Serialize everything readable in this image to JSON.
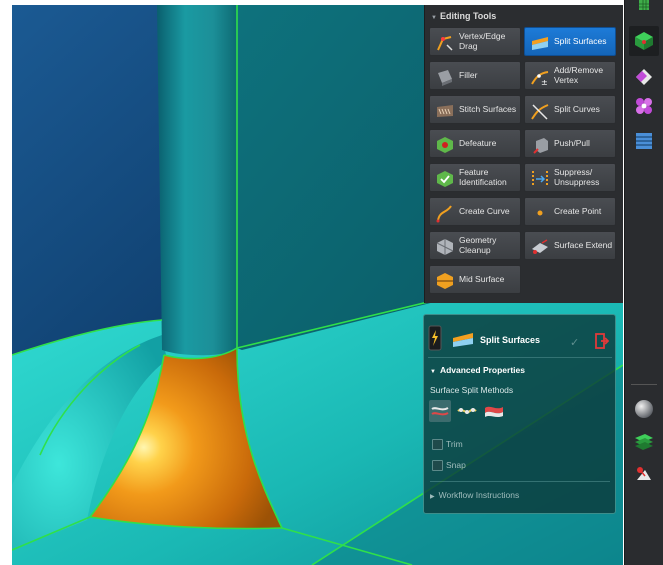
{
  "editing_tools": {
    "title": "Editing Tools",
    "buttons": [
      {
        "id": "vertex-edge-drag",
        "label": "Vertex/Edge\nDrag",
        "icon": "vertex-edge-drag-icon",
        "active": false
      },
      {
        "id": "split-surfaces",
        "label": "Split Surfaces",
        "icon": "split-surfaces-icon",
        "active": true
      },
      {
        "id": "filler",
        "label": "Filler",
        "icon": "filler-icon",
        "active": false
      },
      {
        "id": "add-remove-vertex",
        "label": "Add/Remove\nVertex",
        "icon": "add-remove-vertex-icon",
        "active": false
      },
      {
        "id": "stitch-surfaces",
        "label": "Stitch Surfaces",
        "icon": "stitch-surfaces-icon",
        "active": false
      },
      {
        "id": "split-curves",
        "label": "Split Curves",
        "icon": "split-curves-icon",
        "active": false
      },
      {
        "id": "defeature",
        "label": "Defeature",
        "icon": "defeature-icon",
        "active": false
      },
      {
        "id": "push-pull",
        "label": "Push/Pull",
        "icon": "push-pull-icon",
        "active": false
      },
      {
        "id": "feature-identification",
        "label": "Feature\nIdentification",
        "icon": "feature-identification-icon",
        "active": false
      },
      {
        "id": "suppress-unsuppress",
        "label": "Suppress/\nUnsuppress",
        "icon": "suppress-unsuppress-icon",
        "active": false
      },
      {
        "id": "create-curve",
        "label": "Create Curve",
        "icon": "create-curve-icon",
        "active": false
      },
      {
        "id": "create-point",
        "label": "Create Point",
        "icon": "create-point-icon",
        "active": false
      },
      {
        "id": "geometry-cleanup",
        "label": "Geometry\nCleanup",
        "icon": "geometry-cleanup-icon",
        "active": false
      },
      {
        "id": "surface-extend",
        "label": "Surface Extend",
        "icon": "surface-extend-icon",
        "active": false
      },
      {
        "id": "mid-surface",
        "label": "Mid Surface",
        "icon": "mid-surface-icon",
        "active": false
      }
    ]
  },
  "split_panel": {
    "title": "Split Surfaces",
    "advanced_label": "Advanced Properties",
    "methods_label": "Surface Split Methods",
    "methods": [
      "split-by-curve-icon",
      "split-by-points-icon",
      "split-by-surface-icon"
    ],
    "trim_label": "Trim",
    "snap_label": "Snap",
    "workflow_label": "Workflow Instructions",
    "trim_checked": false,
    "snap_checked": false
  },
  "colors": {
    "accent": "#1a73d0",
    "selection_edge": "#2fe04a",
    "surface_cyan": "#22c8c0",
    "surface_orange": "#e07a10",
    "viewport_bg": "#0f3d6b"
  }
}
